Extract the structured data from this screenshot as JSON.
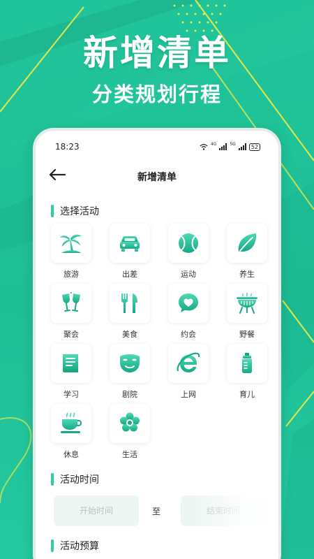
{
  "promo": {
    "title": "新增清单",
    "subtitle": "分类规划行程"
  },
  "status_bar": {
    "time": "18:23",
    "network_1": "4G",
    "network_2": "5G",
    "battery": "52"
  },
  "nav": {
    "title": "新增清单"
  },
  "sections": {
    "activity": "选择活动",
    "time": "活动时间",
    "budget": "活动预算"
  },
  "activities": [
    {
      "label": "旅游",
      "icon": "palm-tree-icon"
    },
    {
      "label": "出差",
      "icon": "car-icon"
    },
    {
      "label": "运动",
      "icon": "tennis-ball-icon"
    },
    {
      "label": "养生",
      "icon": "leaf-icon"
    },
    {
      "label": "聚会",
      "icon": "champagne-glasses-icon"
    },
    {
      "label": "美食",
      "icon": "fork-knife-icon"
    },
    {
      "label": "约会",
      "icon": "heart-bubble-icon"
    },
    {
      "label": "野餐",
      "icon": "grill-icon"
    },
    {
      "label": "学习",
      "icon": "book-icon"
    },
    {
      "label": "剧院",
      "icon": "theater-mask-icon"
    },
    {
      "label": "上网",
      "icon": "browser-e-icon"
    },
    {
      "label": "育儿",
      "icon": "baby-bottle-icon"
    },
    {
      "label": "休息",
      "icon": "coffee-cup-icon"
    },
    {
      "label": "生活",
      "icon": "flower-icon"
    }
  ],
  "time_range": {
    "start_placeholder": "开始时间",
    "separator": "至",
    "end_placeholder": "结束时间"
  },
  "colors": {
    "background": "#20c49a",
    "accent": "#2ccfa3",
    "icon_gradient_top": "#4fd9b5",
    "icon_gradient_bottom": "#17a884",
    "deco_line": "#e3e84a"
  }
}
